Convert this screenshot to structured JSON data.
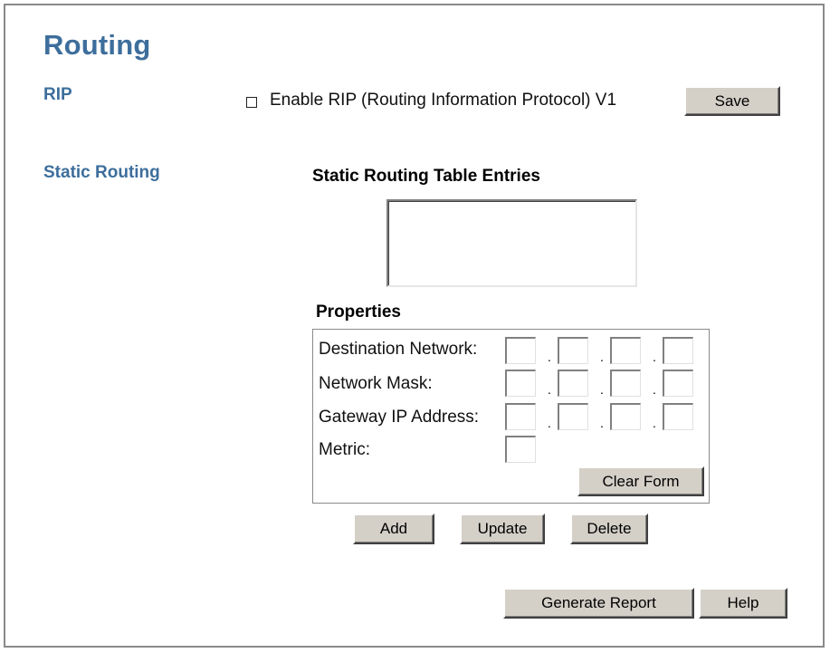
{
  "page": {
    "title": "Routing"
  },
  "rip": {
    "section_label": "RIP",
    "checkbox_label": "Enable RIP (Routing Information Protocol) V1",
    "checked": false,
    "save_label": "Save"
  },
  "static_routing": {
    "section_label": "Static Routing",
    "table_heading": "Static Routing Table Entries",
    "table_entries": [],
    "properties_heading": "Properties",
    "fields": {
      "destination_network": {
        "label": "Destination Network:",
        "octets": [
          "",
          "",
          "",
          ""
        ]
      },
      "network_mask": {
        "label": "Network Mask:",
        "octets": [
          "",
          "",
          "",
          ""
        ]
      },
      "gateway_ip": {
        "label": "Gateway IP Address:",
        "octets": [
          "",
          "",
          "",
          ""
        ]
      },
      "metric": {
        "label": "Metric:",
        "value": ""
      }
    },
    "ip_separator": ".",
    "clear_form_label": "Clear Form",
    "add_label": "Add",
    "update_label": "Update",
    "delete_label": "Delete"
  },
  "footer": {
    "generate_report_label": "Generate Report",
    "help_label": "Help"
  },
  "colors": {
    "heading_blue": "#3d6e9c",
    "button_face": "#d4d0c8"
  }
}
